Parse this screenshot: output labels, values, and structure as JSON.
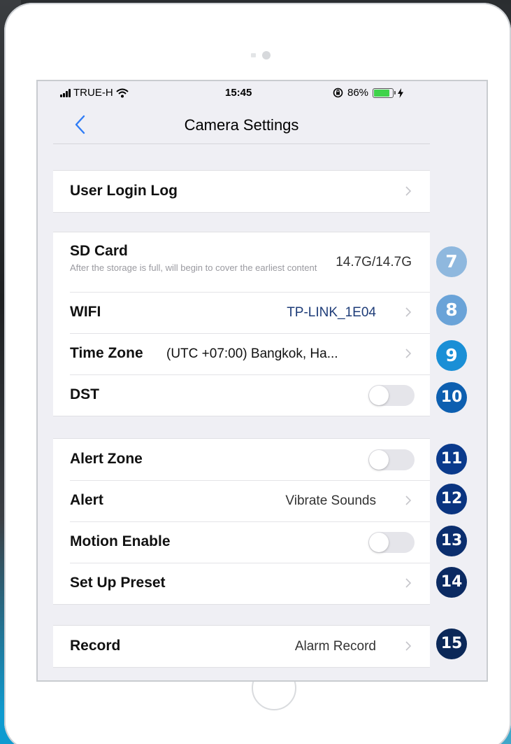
{
  "status_bar": {
    "carrier": "TRUE-H",
    "time": "15:45",
    "battery": "86%",
    "battery_level": 0.86
  },
  "nav": {
    "title": "Camera Settings"
  },
  "rows": {
    "user_login_log": {
      "label": "User Login Log"
    },
    "sd_card": {
      "label": "SD Card",
      "subtitle": "After the storage is full, will begin to cover the earliest content",
      "value": "14.7G/14.7G"
    },
    "wifi": {
      "label": "WIFI",
      "value": "TP-LINK_1E04"
    },
    "time_zone": {
      "label": "Time Zone",
      "value": "(UTC +07:00) Bangkok, Ha..."
    },
    "dst": {
      "label": "DST",
      "on": false
    },
    "alert_zone": {
      "label": "Alert Zone",
      "on": false
    },
    "alert": {
      "label": "Alert",
      "value": "Vibrate Sounds"
    },
    "motion_enable": {
      "label": "Motion Enable",
      "on": false
    },
    "set_up_preset": {
      "label": "Set Up Preset"
    },
    "record": {
      "label": "Record",
      "value": "Alarm Record"
    }
  },
  "badges": {
    "b7": {
      "text": "7",
      "color": "#8fb8de"
    },
    "b8": {
      "text": "8",
      "color": "#6aa3d8"
    },
    "b9": {
      "text": "9",
      "color": "#1a8fd6"
    },
    "b10": {
      "text": "10",
      "color": "#0d5fb0"
    },
    "b11": {
      "text": "11",
      "color": "#0a3a8c"
    },
    "b12": {
      "text": "12",
      "color": "#0a3480"
    },
    "b13": {
      "text": "13",
      "color": "#0b2e6e"
    },
    "b14": {
      "text": "14",
      "color": "#0b2a62"
    },
    "b15": {
      "text": "15",
      "color": "#0b2858"
    }
  }
}
